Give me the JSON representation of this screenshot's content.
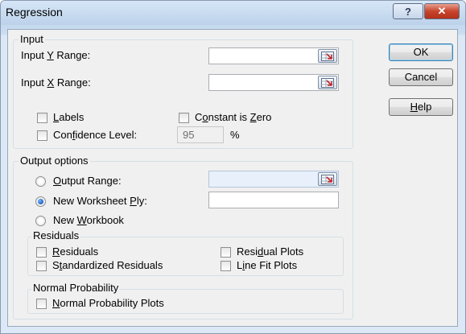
{
  "window": {
    "title": "Regression",
    "help_glyph": "?",
    "close_glyph": "✕"
  },
  "buttons": {
    "ok": "OK",
    "cancel": "Cancel",
    "help_pre": "",
    "help_u": "H",
    "help_post": "elp"
  },
  "input": {
    "group_label": "Input",
    "y_range": {
      "pre": "Input ",
      "u": "Y",
      "post": " Range:",
      "value": ""
    },
    "x_range": {
      "pre": "Input ",
      "u": "X",
      "post": " Range:",
      "value": ""
    },
    "labels": {
      "pre": "",
      "u": "L",
      "post": "abels",
      "checked": false
    },
    "constant_zero": {
      "pre": "C",
      "u": "o",
      "post": "nstant is ",
      "u2": "Z",
      "post2": "ero",
      "checked": false
    },
    "confidence": {
      "pre": "Con",
      "u": "f",
      "post": "idence Level:",
      "checked": false,
      "value": "95",
      "unit": "%"
    }
  },
  "output": {
    "group_label": "Output options",
    "output_range": {
      "pre": "",
      "u": "O",
      "post": "utput Range:",
      "selected": false,
      "value": ""
    },
    "new_ply": {
      "pre": "New Worksheet ",
      "u": "P",
      "post": "ly:",
      "selected": true,
      "value": ""
    },
    "new_workbook": {
      "pre": "New ",
      "u": "W",
      "post": "orkbook",
      "selected": false
    }
  },
  "residuals": {
    "group_label": "Residuals",
    "residuals": {
      "pre": "",
      "u": "R",
      "post": "esiduals"
    },
    "standardized": {
      "pre": "S",
      "u": "t",
      "post": "andardized Residuals"
    },
    "residual_plots": {
      "pre": "Resi",
      "u": "d",
      "post": "ual Plots"
    },
    "line_fit": {
      "pre": "L",
      "u": "i",
      "post": "ne Fit Plots"
    }
  },
  "normal": {
    "group_label": "Normal Probability",
    "plots": {
      "pre": "",
      "u": "N",
      "post": "ormal Probability Plots"
    }
  },
  "colors": {
    "close_red": "#c8452c",
    "accent": "#3c7fb1"
  }
}
